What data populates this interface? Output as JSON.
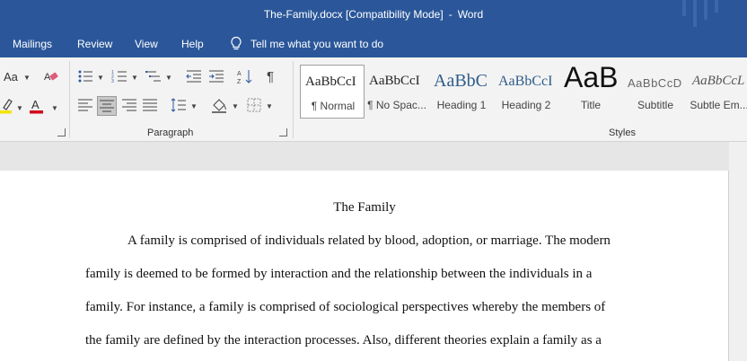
{
  "titlebar": {
    "filename": "The-Family.docx [Compatibility Mode]",
    "separator": "-",
    "app": "Word"
  },
  "menu": {
    "items": [
      "Mailings",
      "Review",
      "View",
      "Help"
    ],
    "tell_me": "Tell me what you want to do"
  },
  "ribbon": {
    "font_group": {
      "change_case_label": "Aa"
    },
    "paragraph_group_label": "Paragraph",
    "styles_group_label": "Styles",
    "styles": [
      {
        "sample": "AaBbCcI",
        "name": "¶ Normal",
        "selected": true
      },
      {
        "sample": "AaBbCcI",
        "name": "¶ No Spac..."
      },
      {
        "sample": "AaBbC",
        "name": "Heading 1"
      },
      {
        "sample": "AaBbCcI",
        "name": "Heading 2"
      },
      {
        "sample": "AaB",
        "name": "Title"
      },
      {
        "sample": "AaBbCcD",
        "name": "Subtitle"
      },
      {
        "sample": "AaBbCcL",
        "name": "Subtle Em..."
      }
    ],
    "colors": {
      "highlight": "#f5e400",
      "font_color": "#d3001c",
      "heading_blue": "#2e5c8a"
    }
  },
  "document": {
    "heading": "The Family",
    "lines": [
      "A family is comprised of individuals related by blood, adoption, or marriage. The modern",
      "family is deemed to be formed by interaction and the relationship between the individuals in a",
      "family. For instance, a family is comprised of sociological perspectives whereby the members of",
      "the family are defined by the interaction processes. Also, different theories explain a family as a"
    ]
  },
  "colors": {
    "brand": "#2b579a",
    "ribbon_bg": "#f3f3f3",
    "canvas_bg": "#e6e6e6"
  }
}
